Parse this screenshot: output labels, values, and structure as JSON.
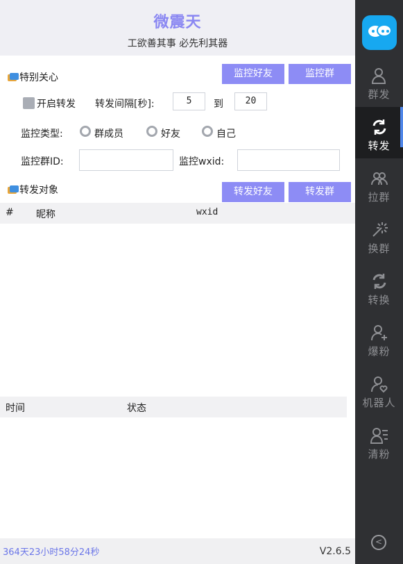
{
  "header": {
    "title": "微震天",
    "subtitle": "工欲善其事 必先利其器"
  },
  "monitor": {
    "section_title": "特别关心",
    "monitor_friends_button": "监控好友",
    "monitor_groups_button": "监控群",
    "enable_forward_label": "开启转发",
    "interval_label": "转发间隔[秒]:",
    "interval_min": "5",
    "to_label": "到",
    "interval_max": "20",
    "type_label": "监控类型:",
    "type_options": [
      "群成员",
      "好友",
      "自己"
    ],
    "group_id_label": "监控群ID:",
    "group_id_value": "",
    "wxid_label": "监控wxid:",
    "wxid_value": ""
  },
  "forward": {
    "section_title": "转发对象",
    "forward_friends_button": "转发好友",
    "forward_groups_button": "转发群",
    "columns": [
      "#",
      "昵称",
      "wxid"
    ]
  },
  "log": {
    "columns": [
      "时间",
      "状态"
    ]
  },
  "sidebar": {
    "items": [
      {
        "label": "群发",
        "icon": "user-icon"
      },
      {
        "label": "转发",
        "icon": "refresh-icon",
        "active": true
      },
      {
        "label": "拉群",
        "icon": "group-icon"
      },
      {
        "label": "换群",
        "icon": "magic-wand-icon"
      },
      {
        "label": "转换",
        "icon": "convert-icon"
      },
      {
        "label": "爆粉",
        "icon": "user-add-icon"
      },
      {
        "label": "机器人",
        "icon": "user-heart-icon"
      },
      {
        "label": "清粉",
        "icon": "user-list-icon"
      }
    ]
  },
  "status": {
    "uptime": "364天23小时58分24秒",
    "version": "V2.6.5"
  },
  "colors": {
    "accent": "#8d8cf5",
    "sidebar_bg": "#2f3033",
    "title": "#8a87f2",
    "active_indicator": "#4f86e8"
  }
}
